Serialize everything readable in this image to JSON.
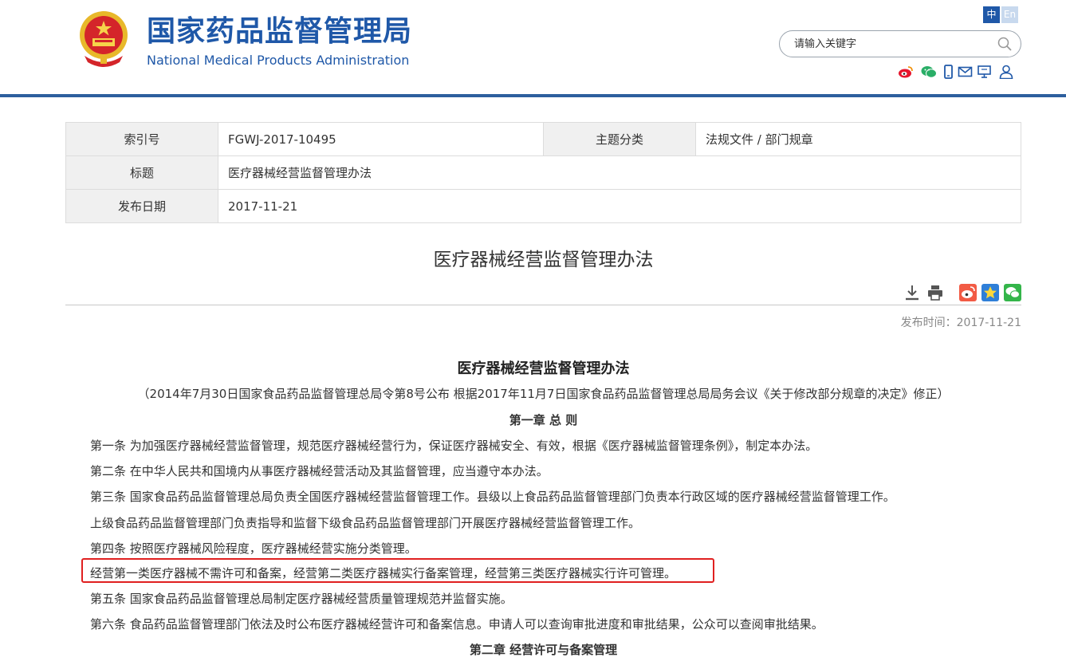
{
  "header": {
    "site_name_cn": "国家药品监督管理局",
    "site_name_en": "National Medical Products Administration",
    "lang_zh": "中",
    "lang_en": "En",
    "search_placeholder": "请输入关键字",
    "social_icons": [
      "weibo-icon",
      "wechat-icon",
      "mobile-icon",
      "mail-icon",
      "monitor-icon",
      "user-icon"
    ],
    "brand_color": "#1f58a8"
  },
  "info": {
    "index_label": "索引号",
    "index_value": "FGWJ-2017-10495",
    "category_label": "主题分类",
    "category_value": "法规文件 / 部门规章",
    "title_label": "标题",
    "title_value": "医疗器械经营监督管理办法",
    "date_label": "发布日期",
    "date_value": "2017-11-21"
  },
  "document": {
    "title": "医疗器械经营监督管理办法",
    "publish_time": "发布时间：2017-11-21",
    "tool_icons": [
      "download-icon",
      "print-icon",
      "weibo-share-icon",
      "favorite-icon",
      "wechat-share-icon"
    ]
  },
  "article": {
    "title": "医疗器械经营监督管理办法",
    "subtitle": "（2014年7月30日国家食品药品监督管理总局令第8号公布 根据2017年11月7日国家食品药品监督管理总局局务会议《关于修改部分规章的决定》修正）",
    "chapter1": "第一章 总 则",
    "p1": "第一条 为加强医疗器械经营监督管理，规范医疗器械经营行为，保证医疗器械安全、有效，根据《医疗器械监督管理条例》，制定本办法。",
    "p2": "第二条 在中华人民共和国境内从事医疗器械经营活动及其监督管理，应当遵守本办法。",
    "p3": "第三条 国家食品药品监督管理总局负责全国医疗器械经营监督管理工作。县级以上食品药品监督管理部门负责本行政区域的医疗器械经营监督管理工作。",
    "p4": "上级食品药品监督管理部门负责指导和监督下级食品药品监督管理部门开展医疗器械经营监督管理工作。",
    "p5": "第四条 按照医疗器械风险程度，医疗器械经营实施分类管理。",
    "p6": "经营第一类医疗器械不需许可和备案，经营第二类医疗器械实行备案管理，经营第三类医疗器械实行许可管理。",
    "p7": "第五条 国家食品药品监督管理总局制定医疗器械经营质量管理规范并监督实施。",
    "p8": "第六条 食品药品监督管理部门依法及时公布医疗器械经营许可和备案信息。申请人可以查询审批进度和审批结果，公众可以查阅审批结果。",
    "chapter2": "第二章 经营许可与备案管理",
    "highlight_color": "#e02020"
  }
}
